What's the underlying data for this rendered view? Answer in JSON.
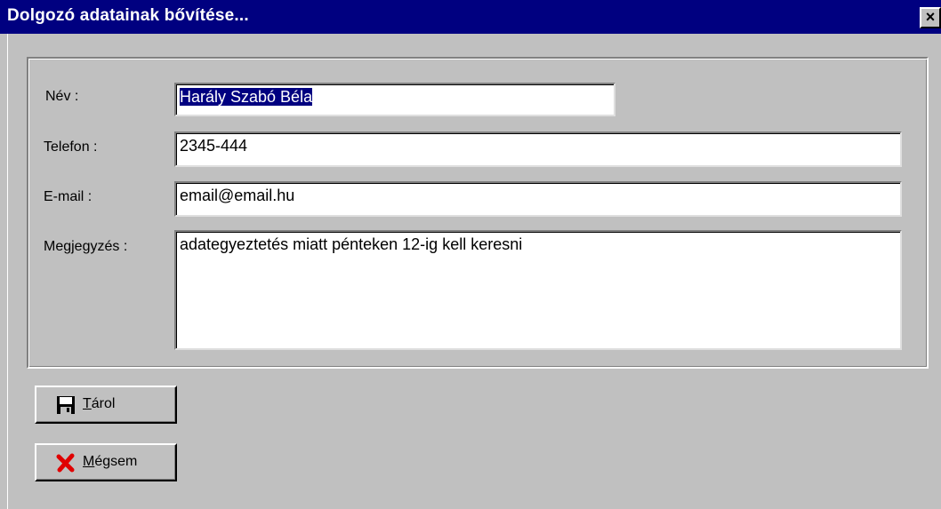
{
  "window": {
    "title": "Dolgozó adatainak bővítése...",
    "close_glyph": "×"
  },
  "form": {
    "name": {
      "label": "Név :",
      "value": "Harály Szabó Béla"
    },
    "phone": {
      "label": "Telefon :",
      "value": "2345-444"
    },
    "email": {
      "label": "E-mail :",
      "value": "email@email.hu"
    },
    "note": {
      "label": "Megjegyzés :",
      "value": "adategyeztetés miatt pénteken 12-ig kell keresni"
    }
  },
  "buttons": {
    "save": {
      "accel": "T",
      "rest": "árol",
      "icon": "floppy-disk-icon"
    },
    "cancel": {
      "accel": "M",
      "rest": "égsem",
      "icon": "red-x-icon"
    }
  },
  "colors": {
    "titlebar": "#000080",
    "face": "#c0c0c0",
    "selection": "#000080",
    "cancel_icon": "#e00000"
  }
}
